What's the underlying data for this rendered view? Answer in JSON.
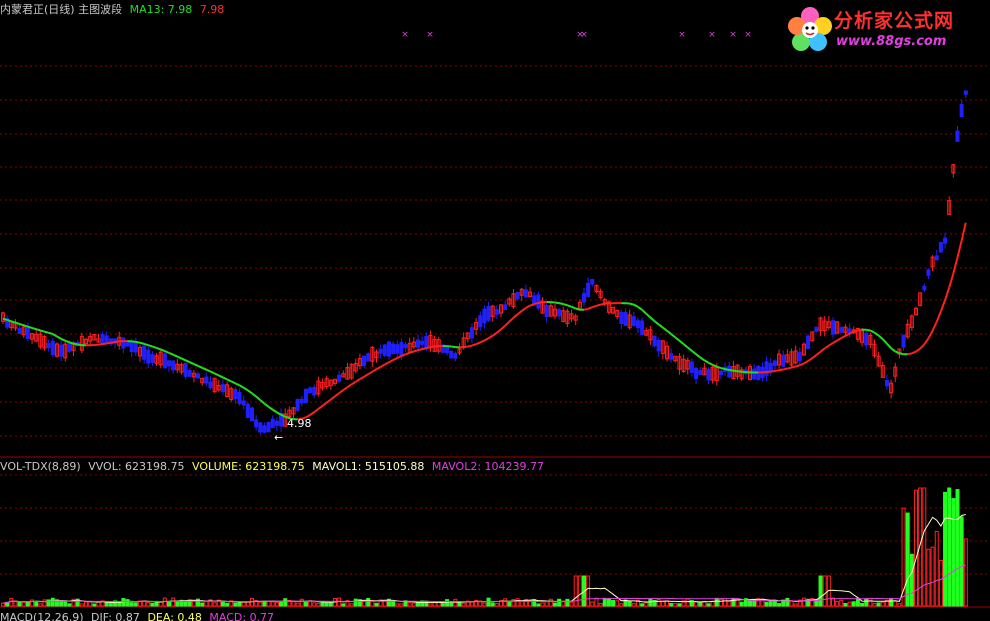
{
  "header_main": {
    "title": "内蒙君正(日线) 主图波段",
    "ma_label": "MA13: 7.98",
    "ma_value_red": "7.98"
  },
  "header_vol": {
    "indicator": "VOL-TDX(8,89)",
    "vvol": "VVOL: 623198.75",
    "volume": "VOLUME: 623198.75",
    "mavol1": "MAVOL1: 515105.88",
    "mavol2": "MAVOL2: 104239.77"
  },
  "header_macd": {
    "indicator": "MACD(12,26,9)",
    "dif": "DIF: 0.87",
    "dea": "DEA: 0.48",
    "macd": "MACD: 0.77"
  },
  "logo": {
    "title": "分析家公式网",
    "url": "www.88gs.com"
  },
  "annotations": {
    "low_label": "4.98",
    "low_arrow": "←"
  },
  "colors": {
    "background": "#000000",
    "up": "#ff2020",
    "down": "#2020ff",
    "ma_up": "#ff2020",
    "ma_down": "#20e020",
    "grid": "#8b0000",
    "vol_up": "#ff2020",
    "vol_down": "#20ff20",
    "mavol1": "#ffffc8",
    "mavol2": "#e040e0",
    "signal": "#e040e0"
  },
  "chart_data": {
    "type": "candlestick",
    "low_price": 4.98,
    "ma13_last": 7.98,
    "signal_marker": "×",
    "signal_count": 9,
    "volume_last": 623198.75,
    "mavol1_last": 515105.88,
    "mavol2_last": 104239.77,
    "dif_last": 0.87,
    "dea_last": 0.48,
    "macd_last": 0.77
  }
}
